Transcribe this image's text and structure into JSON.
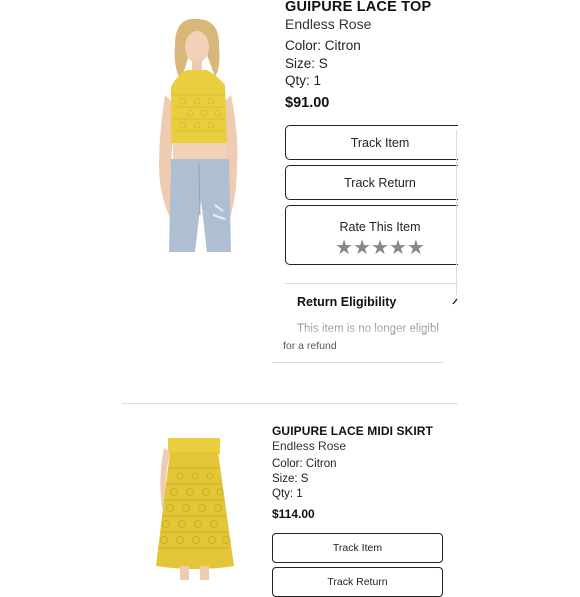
{
  "items": [
    {
      "title": "GUIPURE LACE TOP",
      "brand": "Endless Rose",
      "color": "Color: Citron",
      "size": "Size: S",
      "qty": "Qty: 1",
      "price": "$91.00",
      "buttons": {
        "track_item": "Track Item",
        "track_return": "Track Return",
        "rate_item": "Rate This Item"
      },
      "rating_stars": "★★★★★",
      "return_eligibility": {
        "heading": "Return Eligibility",
        "text_line1": "This item is no longer eligibl",
        "text_line2": "for a refund"
      }
    },
    {
      "title": "GUIPURE LACE MIDI SKIRT",
      "brand": "Endless Rose",
      "color": "Color: Citron",
      "size": "Size: S",
      "qty": "Qty: 1",
      "price": "$114.00",
      "buttons": {
        "track_item": "Track Item",
        "track_return": "Track Return"
      }
    }
  ],
  "colors": {
    "citron": "#e9cf3f",
    "denim": "#aebfd2",
    "border": "#222222",
    "star": "#888888"
  }
}
